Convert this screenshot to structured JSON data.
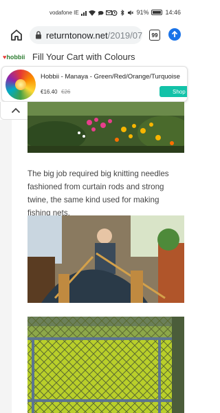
{
  "status_bar": {
    "carrier": "vodafone IE",
    "battery": "91%",
    "time": "14:46"
  },
  "browser": {
    "url_host": "returntonow.net",
    "url_path": "/2019/07",
    "tab_count": "99"
  },
  "ad": {
    "brand": "hobbii",
    "headline": "Fill Your Cart with Colours",
    "product_name": "Hobbii - Manaya - Green/Red/Orange/Turquoise",
    "price": "€16.40",
    "old_price": "€26",
    "shop_label": "Shop n"
  },
  "article": {
    "paragraph": "The big job required big knitting needles fashioned from curtain rods and strong twine, the same kind used for making fishing nets."
  }
}
